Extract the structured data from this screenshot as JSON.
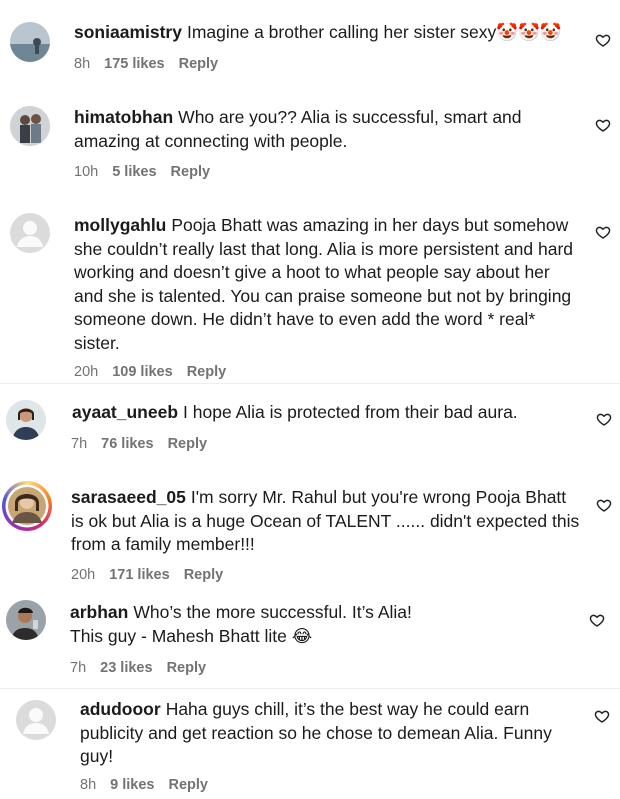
{
  "comments": [
    {
      "username": "soniaamistry",
      "text": "Imagine a brother calling her sister sexy🤡🤡🤡",
      "time": "8h",
      "likes": "175 likes",
      "reply": "Reply",
      "avatar": "landscape-photo-avatar",
      "like_icon": "heart-outline-icon"
    },
    {
      "username": "himatobhan",
      "text": "Who are you?? Alia is successful, smart and amazing at connecting with people.",
      "time": "10h",
      "likes": "5 likes",
      "reply": "Reply",
      "avatar": "couple-photo-avatar",
      "like_icon": "heart-outline-icon"
    },
    {
      "username": "mollygahlu",
      "text": "Pooja Bhatt was amazing in her days but somehow she couldn’t really last that long. Alia is more persistent and hard working and doesn’t give a hoot to what people say about her and she is talented. You can praise someone but not by bringing someone down. He didn’t have to even add the word * real* sister.",
      "time": "20h",
      "likes": "109 likes",
      "reply": "Reply",
      "avatar": "default-user-avatar",
      "like_icon": "heart-outline-icon"
    },
    {
      "username": "ayaat_uneeb",
      "text": "I hope Alia is protected from their bad aura.",
      "time": "7h",
      "likes": "76 likes",
      "reply": "Reply",
      "avatar": "portrait-photo-avatar",
      "like_icon": "heart-outline-icon"
    },
    {
      "username": "sarasaeed_05",
      "text": "I'm sorry Mr. Rahul but you're wrong Pooja Bhatt is ok but Alia is a huge Ocean of TALENT ...... didn't expected this from a family member!!!",
      "time": "20h",
      "likes": "171 likes",
      "reply": "Reply",
      "avatar": "story-ring-photo-avatar",
      "like_icon": "heart-outline-icon"
    },
    {
      "username": "arbhan",
      "text": "Who’s the more successful. It’s Alia! This guy - Mahesh Bhatt lite 😂",
      "time": "7h",
      "likes": "23 likes",
      "reply": "Reply",
      "avatar": "man-photo-avatar",
      "like_icon": "heart-outline-icon"
    },
    {
      "username": "adudooor",
      "text": "Haha guys chill, it’s the best way he could earn publicity and get reaction so he chose to demean Alia. Funny guy!",
      "time": "8h",
      "likes": "9 likes",
      "reply": "Reply",
      "avatar": "default-user-avatar",
      "like_icon": "heart-outline-icon"
    }
  ]
}
